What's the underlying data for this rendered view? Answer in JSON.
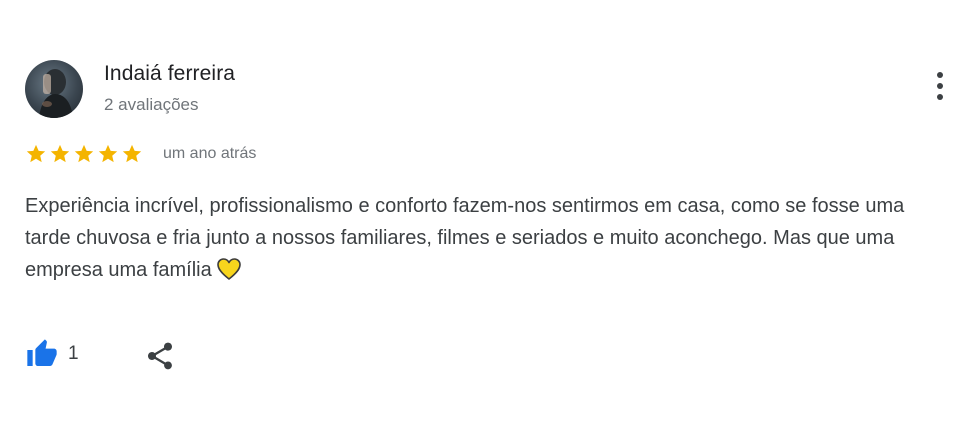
{
  "review": {
    "reviewer_name": "Indaiá ferreira",
    "review_count": "2 avaliações",
    "rating": 5,
    "time_ago": "um ano atrás",
    "text": "Experiência incrível, profissionalismo e conforto fazem-nos sentirmos em casa, como se fosse uma tarde chuvosa e fria junto a nossos familiares, filmes e seriados e muito aconchego. Mas que uma empresa uma família",
    "like_count": "1"
  },
  "colors": {
    "star": "#F4B400",
    "like": "#1A73E8",
    "heart": "#F7D51D"
  },
  "icons": [
    "avatar",
    "star-icon",
    "yellow-heart-icon",
    "thumbs-up-icon",
    "share-icon",
    "more-vert-icon"
  ]
}
